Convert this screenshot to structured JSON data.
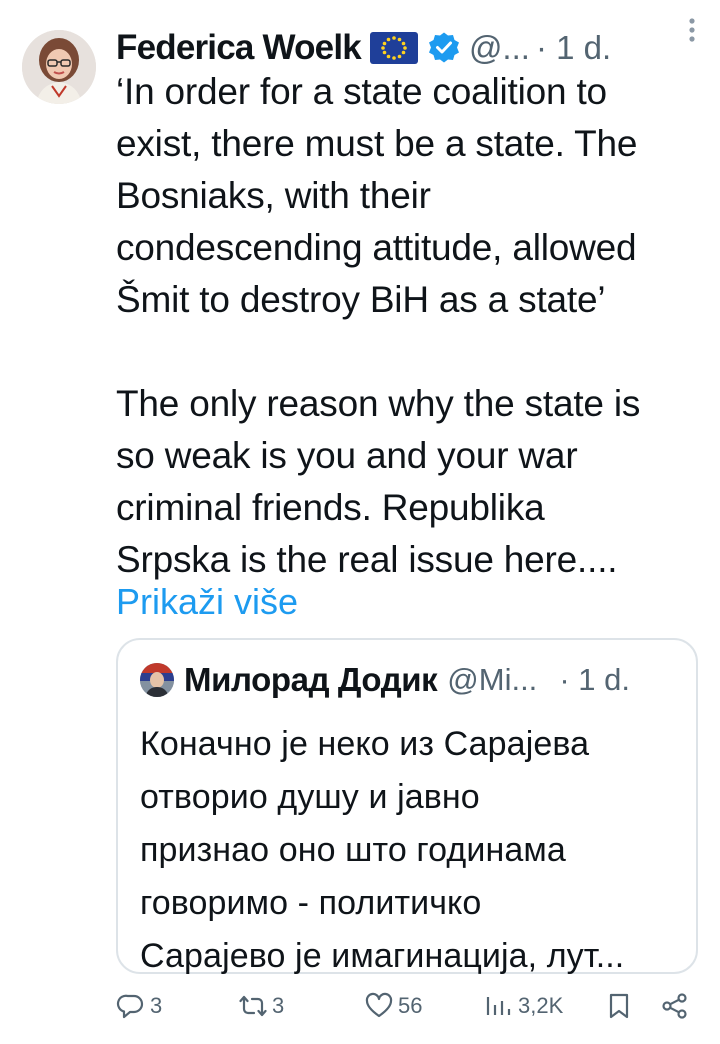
{
  "tweet": {
    "author_name": "Federica Woelk",
    "handle": "@...",
    "time": "· 1 d.",
    "body_lines": [
      "‘In order for a state coalition to",
      "exist, there must be a state. The",
      "Bosniaks, with their",
      "condescending attitude, allowed",
      "Šmit to destroy BiH as a state’",
      "The only reason why the state is",
      "so weak is you and your war",
      "criminal friends. Republika",
      "Srpska is the real issue here...."
    ],
    "show_more": "Prikaži više"
  },
  "quote": {
    "author_name": "Милорад Додик",
    "handle": "@Mi...",
    "time": "· 1 d.",
    "body_lines": [
      "Коначно је неко из Сарајева",
      "отворио душу и јавно",
      "признао оно што годинама",
      "говоримо - политичко",
      "Сарајево је имагинација, лут..."
    ]
  },
  "actions": {
    "replies": "3",
    "reposts": "3",
    "likes": "56",
    "views": "3,2K"
  },
  "icons": [
    "more-icon",
    "verified-icon",
    "eu-flag-icon",
    "reply-icon",
    "repost-icon",
    "like-icon",
    "views-icon",
    "bookmark-icon",
    "share-icon"
  ],
  "colors": {
    "text": "#0f1419",
    "secondary": "#536471",
    "link": "#1d9bf0",
    "verified": "#1d9bf0",
    "border": "#dde3e8"
  }
}
